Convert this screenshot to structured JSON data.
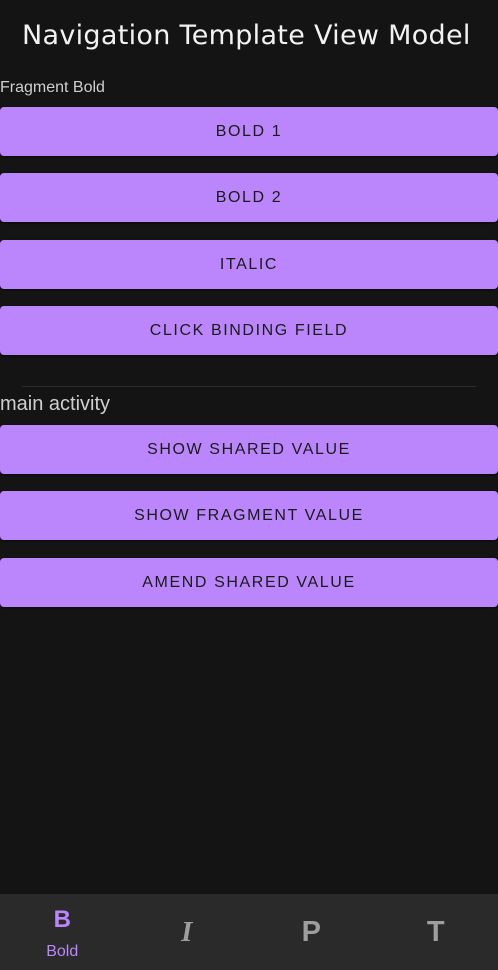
{
  "app_bar": {
    "title": "Navigation Template View Model"
  },
  "fragment_section": {
    "label": "Fragment Bold",
    "buttons": [
      "BOLD 1",
      "BOLD 2",
      "ITALIC",
      "CLICK BINDING FIELD"
    ]
  },
  "activity_section": {
    "label": "main activity",
    "buttons": [
      "SHOW SHARED VALUE",
      "SHOW FRAGMENT VALUE",
      "AMEND SHARED VALUE"
    ]
  },
  "bottom_nav": {
    "items": [
      {
        "icon_char": "B",
        "icon": "bold-icon",
        "label": "Bold",
        "active": true
      },
      {
        "icon_char": "I",
        "icon": "italic-icon",
        "label": "",
        "active": false
      },
      {
        "icon_char": "P",
        "icon": "paragraph-icon",
        "label": "",
        "active": false
      },
      {
        "icon_char": "T",
        "icon": "text-icon",
        "label": "",
        "active": false
      }
    ]
  },
  "colors": {
    "background": "#141414",
    "accent": "#bb86fc",
    "nav_background": "#2a2a2a",
    "inactive_icon": "#9e9e9e"
  }
}
